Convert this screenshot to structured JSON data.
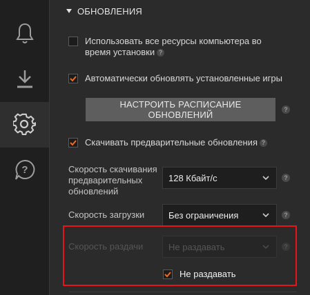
{
  "sidebar": {
    "items": [
      {
        "name": "notifications",
        "icon": "bell-icon"
      },
      {
        "name": "downloads",
        "icon": "download-icon"
      },
      {
        "name": "settings",
        "icon": "gear-icon",
        "active": true
      },
      {
        "name": "help",
        "icon": "help-chat-icon"
      }
    ]
  },
  "section": {
    "title": "ОБНОВЛЕНИЯ"
  },
  "options": {
    "use_all_resources": {
      "label_line1": "Использовать все ресурсы компьютера во",
      "label_line2": "время установки",
      "checked": false
    },
    "auto_update": {
      "label": "Автоматически обновлять установленные игры",
      "checked": true
    },
    "schedule_button": "НАСТРОИТЬ РАСПИСАНИЕ ОБНОВЛЕНИЙ",
    "preload_updates": {
      "label": "Скачивать предварительные обновления",
      "checked": true
    }
  },
  "settings": {
    "preload_speed": {
      "label_line1": "Скорость скачивания",
      "label_line2": "предварительных",
      "label_line3": "обновлений",
      "value": "128 Кбайт/с"
    },
    "download_speed": {
      "label": "Скорость загрузки",
      "value": "Без ограничения"
    },
    "upload_speed": {
      "label": "Скорость раздачи",
      "value": "Не раздавать",
      "disabled": true
    },
    "no_seeding": {
      "label": "Не раздавать",
      "checked": true
    }
  },
  "help_glyph": "?",
  "colors": {
    "accent": "#f26b21",
    "highlight": "#e8141a",
    "background": "#2b2b2b",
    "sidebar": "#1f1f1f"
  }
}
